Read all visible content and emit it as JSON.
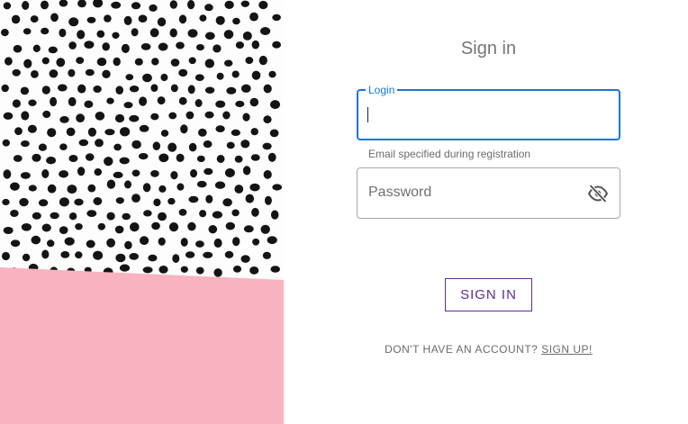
{
  "colors": {
    "accent": "#1976d2",
    "button": "#5e2d91",
    "pink": "#f9b2bf",
    "dot": "#141414"
  },
  "artwork": {
    "description_icon": "polka-dot-pink-artwork"
  },
  "form": {
    "title": "Sign in",
    "login": {
      "label": "Login",
      "value": "",
      "helper": "Email specified during registration"
    },
    "password": {
      "placeholder": "Password",
      "visibility_icon": "eye-off-icon"
    },
    "submit_label": "Sign in",
    "signup_prompt": "Don't have an account?",
    "signup_link": "Sign up!"
  }
}
